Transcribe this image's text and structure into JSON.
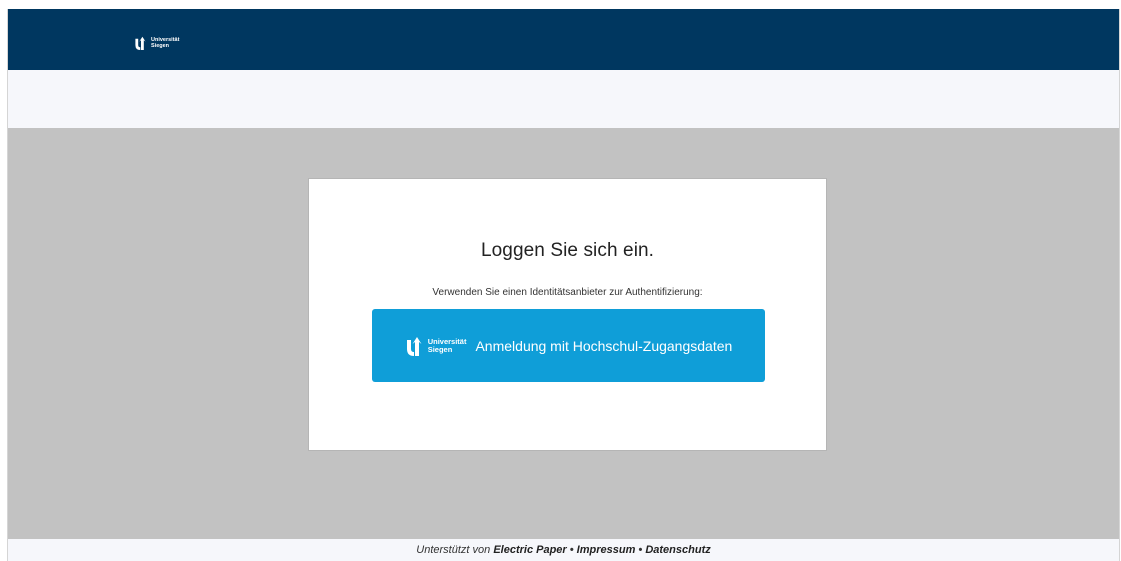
{
  "header": {
    "brand_line1": "Universität",
    "brand_line2": "Siegen"
  },
  "login": {
    "title": "Loggen Sie sich ein.",
    "subtitle": "Verwenden Sie einen Identitätsanbieter zur Authentifizierung:",
    "idp_button": {
      "logo_line1": "Universität",
      "logo_line2": "Siegen",
      "label": "Anmeldung mit Hochschul-Zugangsdaten"
    }
  },
  "footer": {
    "prefix": "Unterstützt von",
    "company": "Electric Paper",
    "separator": "•",
    "impressum": "Impressum",
    "datenschutz": "Datenschutz"
  },
  "colors": {
    "topbar": "#003760",
    "button": "#0f9ed8",
    "background": "#c2c2c2"
  }
}
